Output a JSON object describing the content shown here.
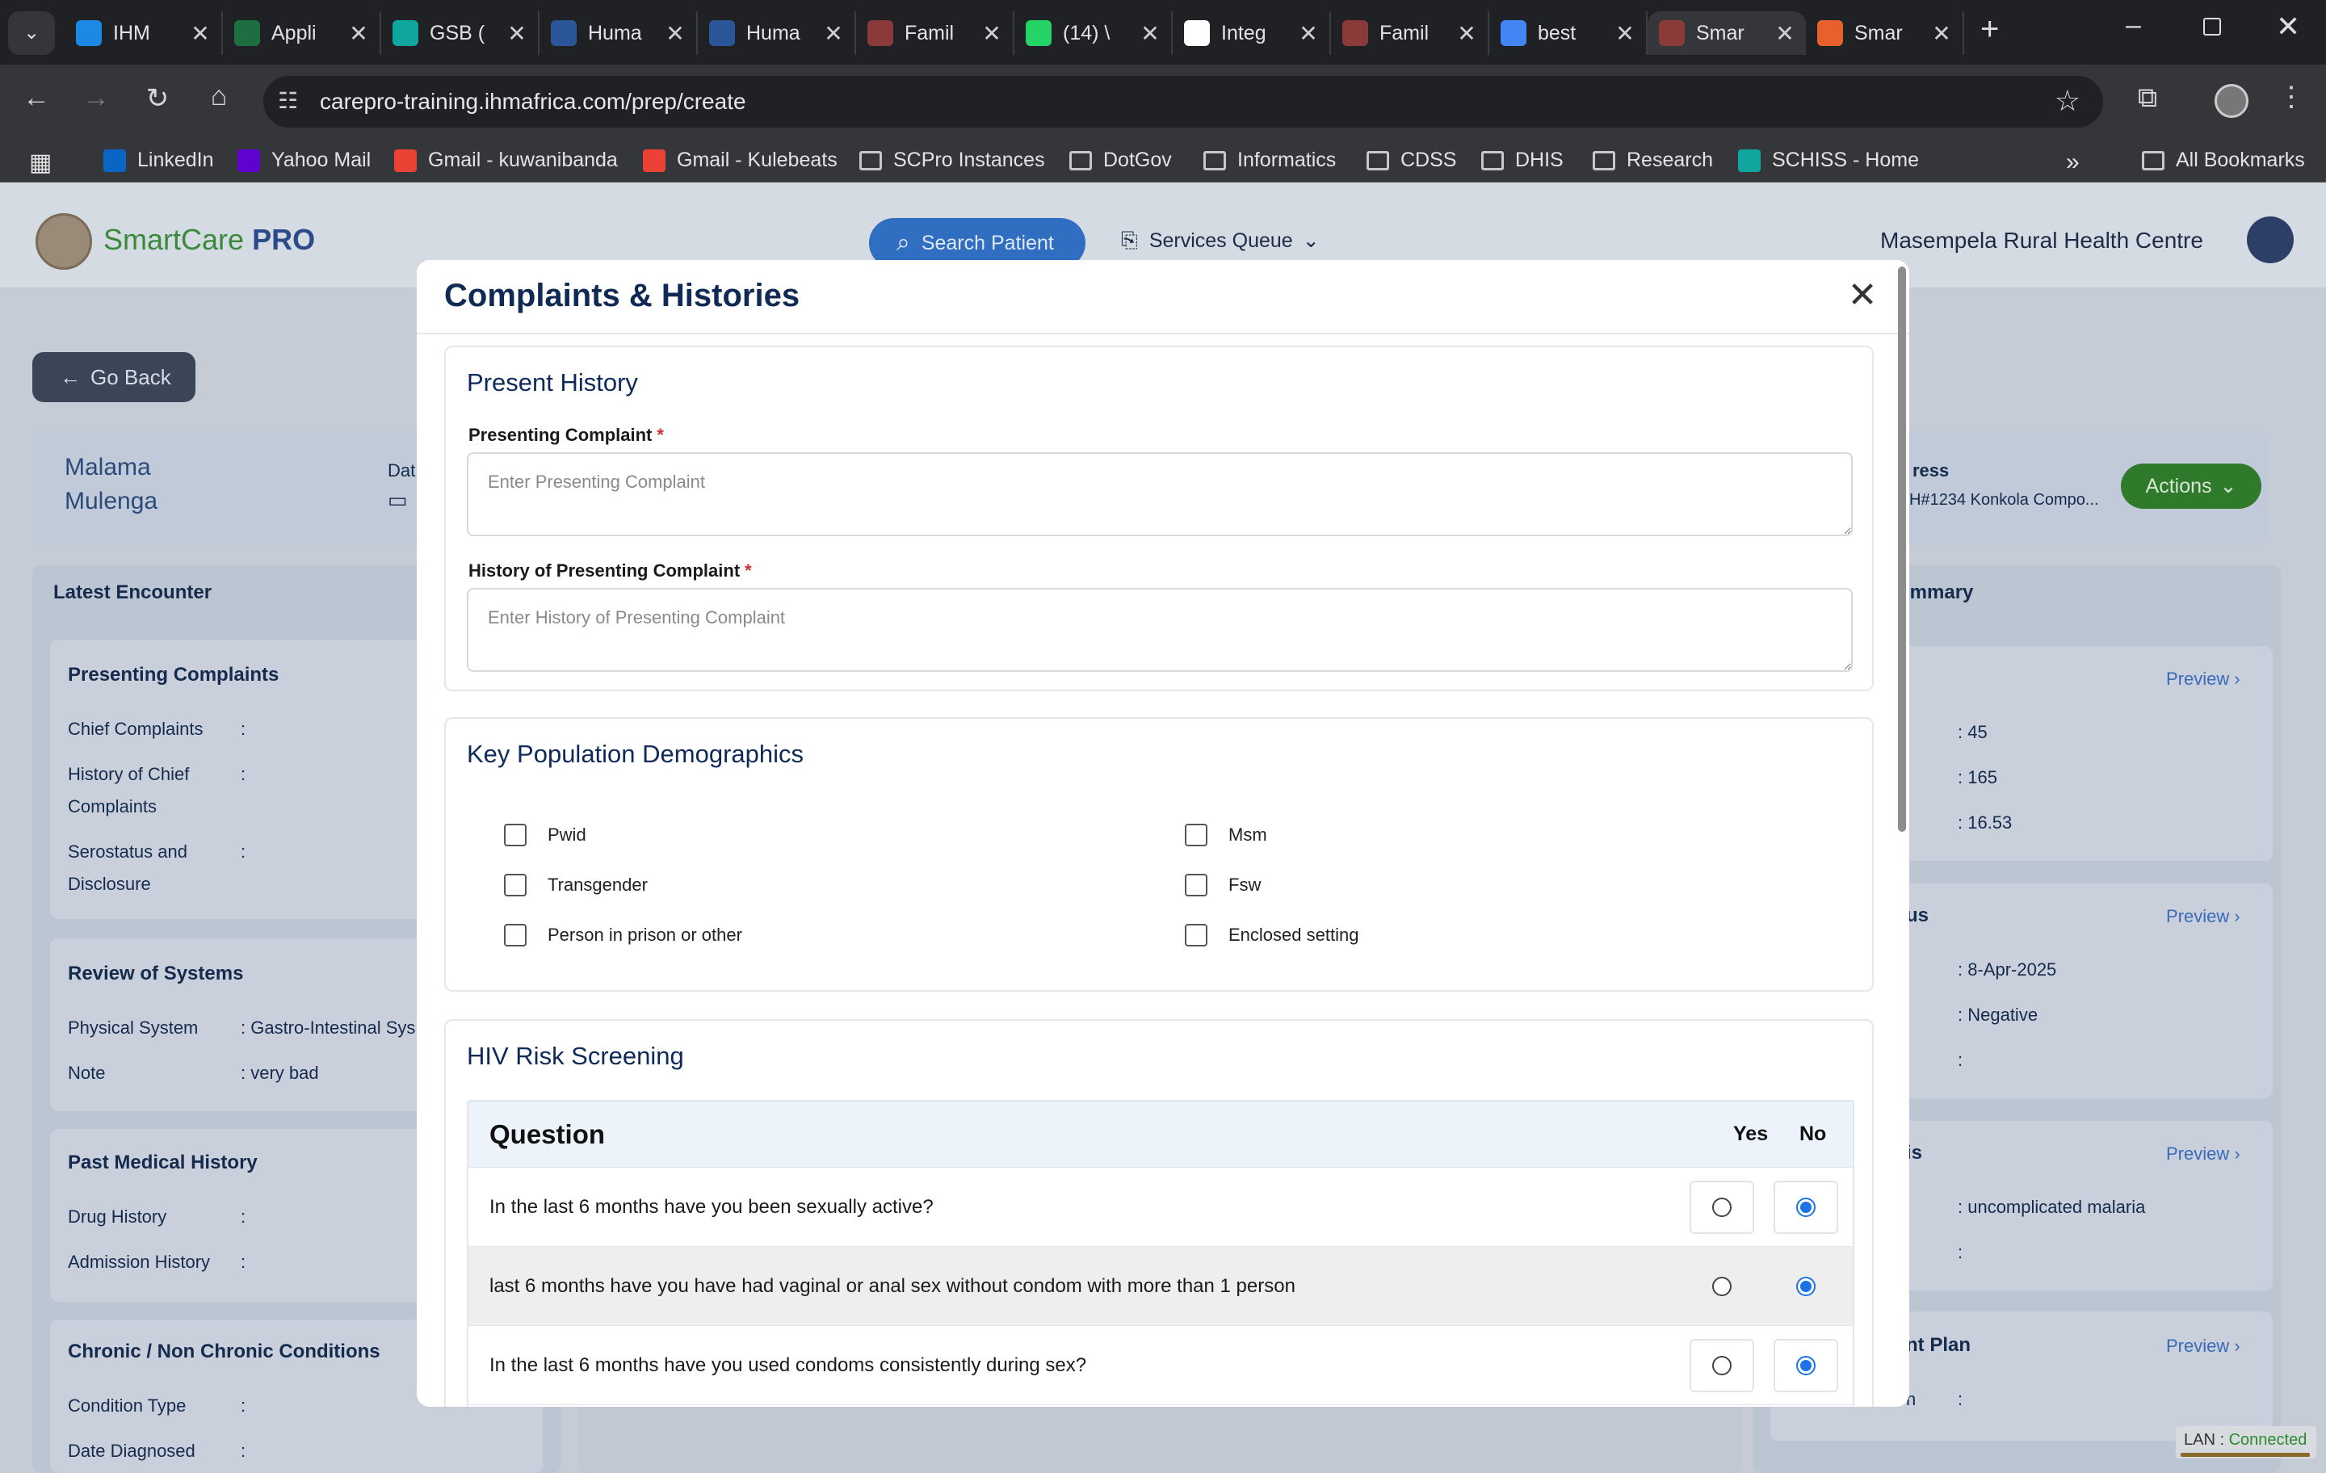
{
  "tabs": [
    {
      "title": "IHM",
      "color": "#1e88e5"
    },
    {
      "title": "Appli",
      "color": "#1d6f42"
    },
    {
      "title": "GSB (",
      "color": "#10a6a0"
    },
    {
      "title": "Huma",
      "color": "#2b579a"
    },
    {
      "title": "Huma",
      "color": "#2b579a"
    },
    {
      "title": "Famil",
      "color": "#8b3a3a"
    },
    {
      "title": "(14) \\",
      "color": "#25d366"
    },
    {
      "title": "Integ",
      "color": "#ffffff"
    },
    {
      "title": "Famil",
      "color": "#8b3a3a"
    },
    {
      "title": "best",
      "color": "#4285f4"
    },
    {
      "title": "Smar",
      "color": "#8b3a3a"
    },
    {
      "title": "Smar",
      "color": "#e8602c"
    }
  ],
  "url": "carepro-training.ihmafrica.com/prep/create",
  "bookmarks": [
    {
      "label": "LinkedIn",
      "kind": "favicon",
      "color": "#0a66c2"
    },
    {
      "label": "Yahoo Mail",
      "kind": "favicon",
      "color": "#6001d2"
    },
    {
      "label": "Gmail - kuwanibanda",
      "kind": "favicon",
      "color": "#ea4335"
    },
    {
      "label": "Gmail - Kulebeats",
      "kind": "favicon",
      "color": "#ea4335"
    },
    {
      "label": "SCPro Instances",
      "kind": "folder"
    },
    {
      "label": "DotGov",
      "kind": "folder"
    },
    {
      "label": "Informatics",
      "kind": "folder"
    },
    {
      "label": "CDSS",
      "kind": "folder"
    },
    {
      "label": "DHIS",
      "kind": "folder"
    },
    {
      "label": "Research",
      "kind": "folder"
    },
    {
      "label": "SCHISS - Home",
      "kind": "favicon",
      "color": "#10a6a0"
    }
  ],
  "all_bookmarks": "All Bookmarks",
  "app": {
    "brand_a": "SmartCare",
    "brand_b": "PRO",
    "search_label": "Search Patient",
    "services_queue": "Services Queue",
    "facility": "Masempela Rural Health Centre",
    "go_back": "Go Back",
    "patient_first": "Malama",
    "patient_last": "Mulenga",
    "dat_label": "Dat",
    "address_label": "ress",
    "address_value": "H#1234 Konkola Compo...",
    "actions": "Actions",
    "latest_encounter": "Latest Encounter",
    "summary": "ummary",
    "presenting_complaints": "Presenting Complaints",
    "chief_complaints": "Chief Complaints",
    "history_chief_1": "History of Chief",
    "history_chief_2": "Complaints",
    "serostatus_1": "Serostatus and",
    "serostatus_2": "Disclosure",
    "review_systems": "Review of Systems",
    "physical_system": "Physical System",
    "physical_value": ": Gastro-Intestinal Sys",
    "note": "Note",
    "note_value": ": very bad",
    "past_medical": "Past Medical History",
    "drug_history": "Drug History",
    "admission_history": "Admission History",
    "chronic": "Chronic / Non Chronic Conditions",
    "condition_type": "Condition Type",
    "date_diagnosed": "Date Diagnosed",
    "colon": ":",
    "preview": "Preview",
    "v45": ": 45",
    "v165": ": 165",
    "v1653": ": 16.53",
    "us": "us",
    "date_val": ": 8-Apr-2025",
    "negative": ": Negative",
    "is": "is",
    "malaria": ": uncomplicated malaria",
    "nt_plan": "nt Plan",
    "n_colon": "n",
    "lan_label": "LAN :",
    "lan_status": "Connected"
  },
  "modal": {
    "title": "Complaints & Histories",
    "present_history": "Present History",
    "presenting_complaint_label": "Presenting Complaint",
    "presenting_complaint_placeholder": "Enter Presenting Complaint",
    "history_label": "History of Presenting Complaint",
    "history_placeholder": "Enter History of Presenting Complaint",
    "required_mark": "*",
    "key_population": "Key Population Demographics",
    "kp_left": [
      "Pwid",
      "Transgender",
      "Person in prison or other"
    ],
    "kp_right": [
      "Msm",
      "Fsw",
      "Enclosed setting"
    ],
    "hiv_title": "HIV Risk Screening",
    "question_header": "Question",
    "yes_header": "Yes",
    "no_header": "No",
    "questions": [
      {
        "text": "In the last 6 months have you been sexually active?",
        "answer": "No"
      },
      {
        "text": "last 6 months have you have had vaginal or anal sex without condom with more than 1 person",
        "answer": "No"
      },
      {
        "text": "In the last 6 months have you used condoms consistently during sex?",
        "answer": "No"
      }
    ]
  }
}
